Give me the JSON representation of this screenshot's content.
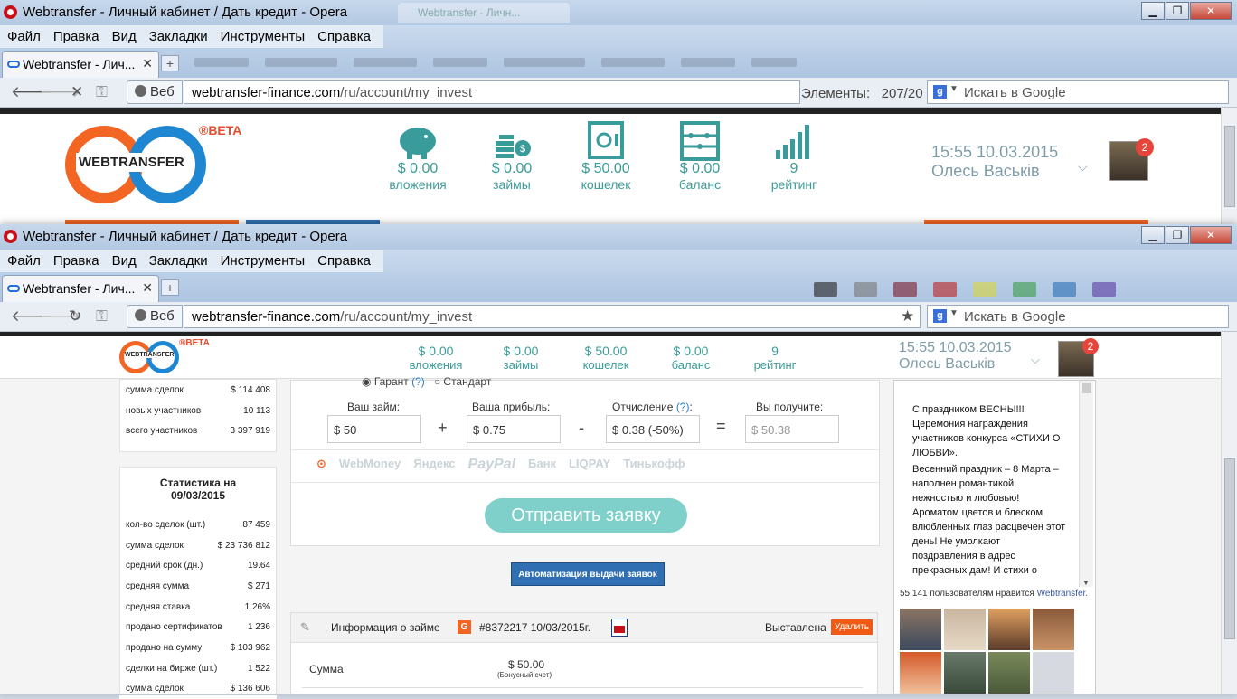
{
  "window1": {
    "title": "Webtransfer - Личный кабинет / Дать кредит - Opera",
    "bg_tab_title": "Webtransfer - Личн...",
    "menu": [
      "Файл",
      "Правка",
      "Вид",
      "Закладки",
      "Инструменты",
      "Справка"
    ],
    "tab_title": "Webtransfer - Лич...",
    "web_label": "Веб",
    "url_host": "webtransfer-finance.com",
    "url_path": "/ru/account/my_invest",
    "elements_label": "Элементы:",
    "elements_count": "207/20",
    "search_placeholder": "Искать в Google"
  },
  "window2": {
    "title": "Webtransfer - Личный кабинет / Дать кредит - Opera",
    "menu": [
      "Файл",
      "Правка",
      "Вид",
      "Закладки",
      "Инструменты",
      "Справка"
    ],
    "tab_title": "Webtransfer - Лич...",
    "web_label": "Веб",
    "url_host": "webtransfer-finance.com",
    "url_path": "/ru/account/my_invest",
    "search_placeholder": "Искать в Google"
  },
  "header": {
    "logo_text": "WEBTRANSFER",
    "beta": "®BETA",
    "stats": [
      {
        "value": "$ 0.00",
        "label": "вложения",
        "icon": "piggy-bank-icon"
      },
      {
        "value": "$ 0.00",
        "label": "займы",
        "icon": "coins-icon"
      },
      {
        "value": "$ 50.00",
        "label": "кошелек",
        "icon": "safe-icon"
      },
      {
        "value": "$ 0.00",
        "label": "баланс",
        "icon": "abacus-icon"
      },
      {
        "value": "9",
        "label": "рейтинг",
        "icon": "rating-chart-icon"
      }
    ],
    "datetime": "15:55 10.03.2015",
    "user_name": "Олесь Васьків",
    "notifications": "2"
  },
  "left_stats_top": [
    {
      "label": "сумма сделок",
      "value": "$ 114 408"
    },
    {
      "label": "новых участников",
      "value": "10 113"
    },
    {
      "label": "всего участников",
      "value": "3 397 919"
    }
  ],
  "stats_card": {
    "title_line1": "Статистика на",
    "title_line2": "09/03/2015",
    "rows": [
      {
        "label": "кол-во сделок (шт.)",
        "value": "87 459"
      },
      {
        "label": "сумма сделок",
        "value": "$ 23 736 812"
      },
      {
        "label": "средний срок (дн.)",
        "value": "19.64"
      },
      {
        "label": "средняя сумма",
        "value": "$ 271"
      },
      {
        "label": "средняя ставка",
        "value": "1.26%"
      },
      {
        "label": "продано сертификатов",
        "value": "1 236"
      },
      {
        "label": "продано на сумму",
        "value": "$ 103 962"
      },
      {
        "label": "сделки на бирже (шт.)",
        "value": "1 522"
      },
      {
        "label": "сумма сделок",
        "value": "$ 136 606"
      }
    ]
  },
  "form": {
    "radio_garant": "Гарант",
    "radio_garant_help": "(?)",
    "radio_standard": "Стандарт",
    "loan_label": "Ваш займ:",
    "loan_value": "$ 50",
    "profit_label": "Ваша прибыль:",
    "profit_value": "$ 0.75",
    "fee_label": "Отчисление",
    "fee_help": "(?)",
    "fee_value": "$ 0.38 (-50%)",
    "receive_label": "Вы получите:",
    "receive_value": "$ 50.38",
    "payment_methods": [
      "WebMoney",
      "Яндекс",
      "PayPal",
      "Банк",
      "LIQPAY",
      "Тинькофф"
    ],
    "submit_label": "Отправить заявку",
    "auto_label": "Автоматизация выдачи заявок"
  },
  "loan_info": {
    "title": "Информация о займе",
    "number": "#8372217 10/03/2015г.",
    "status": "Выставлена",
    "delete_label": "Удалить",
    "sum_label": "Сумма",
    "sum_value": "$ 50.00",
    "sum_note": "(Бонусный счет)"
  },
  "social": {
    "text1": "С праздником ВЕСНЫ!!! Церемония награждения участников конкурса «СТИХИ О ЛЮБВИ».",
    "text2": "Весенний праздник – 8 Марта – наполнен романтикой, нежностью и любовью! Ароматом цветов и блеском влюбленных глаз расцвечен этот день! Не умолкают поздравления в адрес прекрасных дам! И стихи о",
    "likes": "55 141 пользователям нравится",
    "likes_link": "Webtransfer."
  },
  "colors": {
    "accent": "#3a9c9a",
    "orange": "#f26522",
    "blue": "#1f86d1"
  }
}
